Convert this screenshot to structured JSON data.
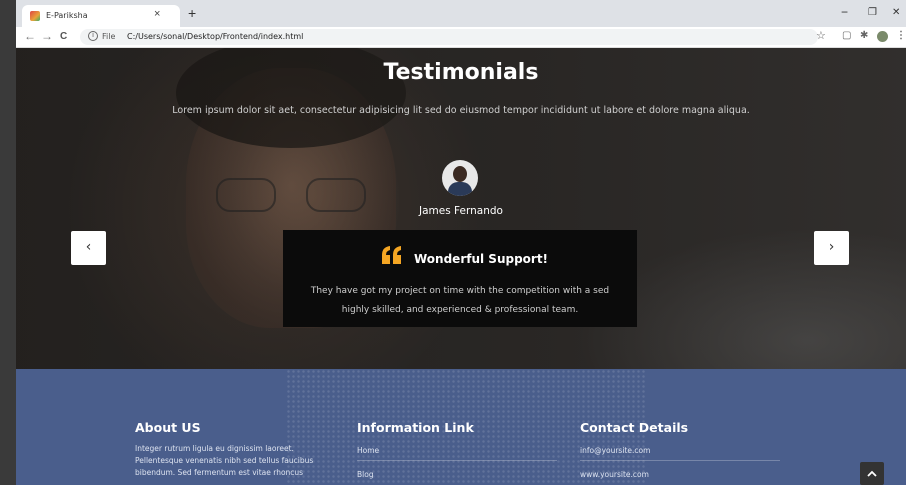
{
  "browser": {
    "tab_title": "E-Pariksha",
    "tab_close": "×",
    "new_tab": "+",
    "minimize": "−",
    "restore": "❐",
    "close": "✕",
    "back": "←",
    "forward": "→",
    "reload": "C",
    "url_scheme": "File",
    "url": "C:/Users/sonal/Desktop/Frontend/index.html"
  },
  "testimonials": {
    "title": "Testimonials",
    "subtitle": "Lorem ipsum dolor sit aet, consectetur adipisicing lit sed do eiusmod tempor incididunt ut labore et dolore magna aliqua.",
    "person_name": "James Fernando",
    "quote_heading": "Wonderful Support!",
    "quote_text": "They have got my project on time with the competition with a sed highly skilled, and experienced & professional team.",
    "prev_label": "‹",
    "next_label": "›",
    "quote_color": "#f5a623"
  },
  "footer": {
    "about_title": "About US",
    "about_text": "Integer rutrum ligula eu dignissim laoreet. Pellentesque venenatis nibh sed tellus faucibus bibendum. Sed fermentum est vitae rhoncus",
    "links_title": "Information Link",
    "links": [
      "Home",
      "Blog"
    ],
    "contact_title": "Contact Details",
    "contacts": [
      "info@yoursite.com",
      "www.yoursite.com"
    ],
    "bg_color": "#4a5e8c"
  },
  "scroll_top_label": "^"
}
